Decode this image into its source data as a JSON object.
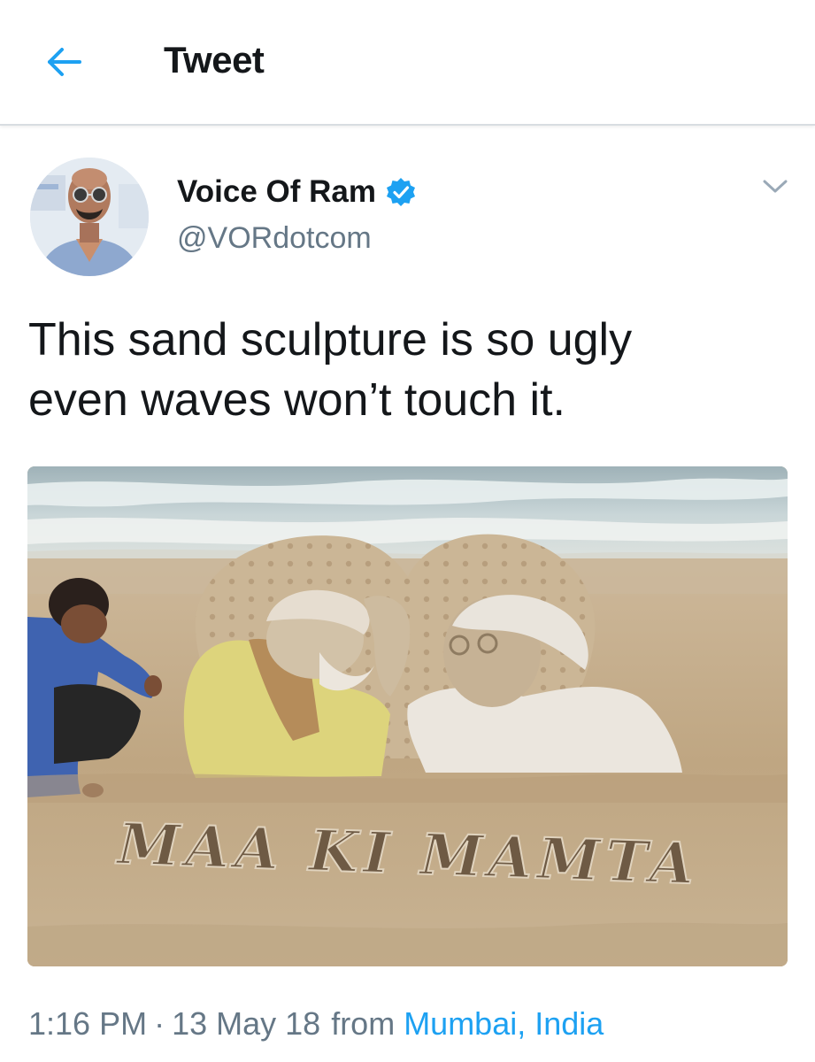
{
  "header": {
    "title": "Tweet",
    "back_icon": "arrow-left-icon"
  },
  "tweet": {
    "author": {
      "display_name": "Voice Of Ram",
      "handle": "@VORdotcom",
      "verified": true,
      "avatar": "avatar-photo"
    },
    "text": "This sand sculpture is so ugly\neven waves won’t touch it.",
    "photo": {
      "sculpture_inscription": "MAA KI MAMTA"
    },
    "meta": {
      "time": "1:16 PM",
      "separator": "·",
      "date": "13 May 18",
      "from_label": "from",
      "location": "Mumbai, India"
    }
  },
  "colors": {
    "accent": "#1da1f2",
    "secondary_text": "#657786",
    "primary_text": "#14171a",
    "divider": "#d8dde1"
  }
}
